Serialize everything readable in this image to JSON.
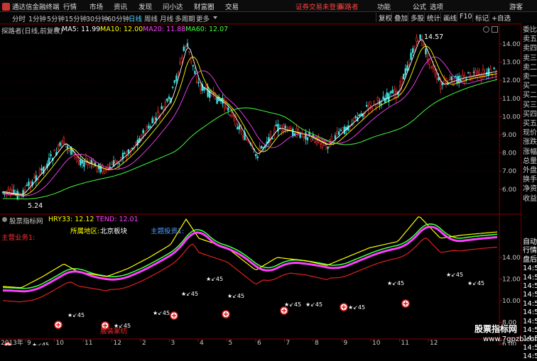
{
  "menubar": {
    "app_name": "通达信金融终端",
    "items": [
      "行情",
      "市场",
      "资讯",
      "发现",
      "问小达",
      "财富圈",
      "交易"
    ],
    "login_warning": "证券交易未登录",
    "stock_name": "探路者",
    "right_items": [
      "功能",
      "公式",
      "选项"
    ],
    "guest": "游客"
  },
  "periodbar": {
    "periods": [
      "分时",
      "1分钟",
      "5分钟",
      "15分钟",
      "30分钟",
      "60分钟",
      "日线",
      "周线",
      "月线",
      "多周期",
      "更多"
    ],
    "active": "日线",
    "tools": [
      "复权",
      "叠加",
      "多股",
      "统计",
      "画线",
      "F10",
      "标记",
      "+自选"
    ]
  },
  "main_chart": {
    "title": "探路者(日线,前复权)",
    "ma": [
      {
        "label": "MA5: 11.99",
        "color": "#ffffff"
      },
      {
        "label": "MA10: 12.00",
        "color": "#ffff00"
      },
      {
        "label": "MA20: 11.88",
        "color": "#ff40ff"
      },
      {
        "label": "MA60: 12.07",
        "color": "#40ff40"
      }
    ],
    "y_ticks": [
      "14.00",
      "13.00",
      "12.00",
      "11.00",
      "10.00",
      "9.00",
      "8.00",
      "7.00",
      "6.00"
    ],
    "high_label": "14.57",
    "low_label": "5.24"
  },
  "indicator": {
    "title": "股票指标网",
    "hry": "HRY33: 12.12",
    "tend": "TEND: 12.01",
    "main_business": "主营业务1:",
    "region_label": "所属地区:",
    "region_value": "北京板块",
    "theme_label": "主题投资1:",
    "y_ticks": [
      "14.00",
      "12.00",
      "10.00",
      "8.00",
      "6.00"
    ],
    "signal_label": "45",
    "bottom_note": "服装家纺"
  },
  "x_axis": {
    "year": "2013年",
    "months": [
      "9",
      "10",
      "11",
      "12",
      "2",
      "3",
      "4",
      "5",
      "6",
      "7",
      "8",
      "9",
      "10",
      "11",
      "12"
    ]
  },
  "right_panel": {
    "top": [
      "委比",
      "卖五",
      "卖四",
      "卖三",
      "卖二",
      "卖一",
      "买一",
      "买二",
      "买三",
      "买四",
      "买五",
      "现价",
      "涨跌",
      "涨幅",
      "总量",
      "外盘",
      "换手",
      "净资",
      "收益"
    ],
    "bottom": [
      "自动",
      "行情",
      "盘后",
      "14:5",
      "14:5",
      "14:5",
      "14:5",
      "14:5",
      "14:5",
      "14:5",
      "14:5",
      "14:5",
      "14:5",
      "14:5"
    ]
  },
  "watermark": {
    "line1": "股票指标网",
    "line2": "www.7gpzb.com"
  }
}
